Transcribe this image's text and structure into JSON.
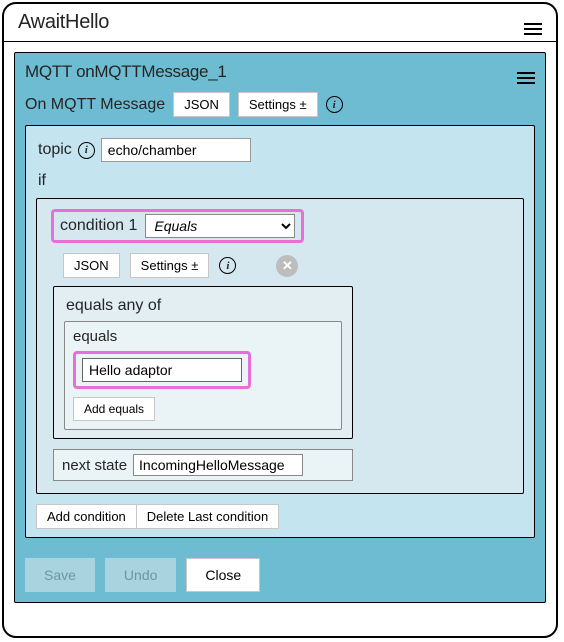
{
  "window": {
    "title": "AwaitHello"
  },
  "mqtt": {
    "title": "MQTT onMQTTMessage_1",
    "row_label": "On MQTT Message",
    "json_button": "JSON",
    "settings_button": "Settings ±"
  },
  "topic": {
    "label": "topic",
    "value": "echo/chamber"
  },
  "if_label": "if",
  "condition": {
    "label": "condition 1",
    "selected_op": "Equals",
    "json_button": "JSON",
    "settings_button": "Settings ±",
    "equals_any_label": "equals any of",
    "equals_label": "equals",
    "equals_value": "Hello adaptor",
    "add_equals_button": "Add equals",
    "next_state_label": "next state",
    "next_state_value": "IncomingHelloMessage",
    "add_condition_button": "Add condition",
    "delete_condition_button": "Delete Last condition"
  },
  "footer": {
    "save": "Save",
    "undo": "Undo",
    "close": "Close"
  }
}
